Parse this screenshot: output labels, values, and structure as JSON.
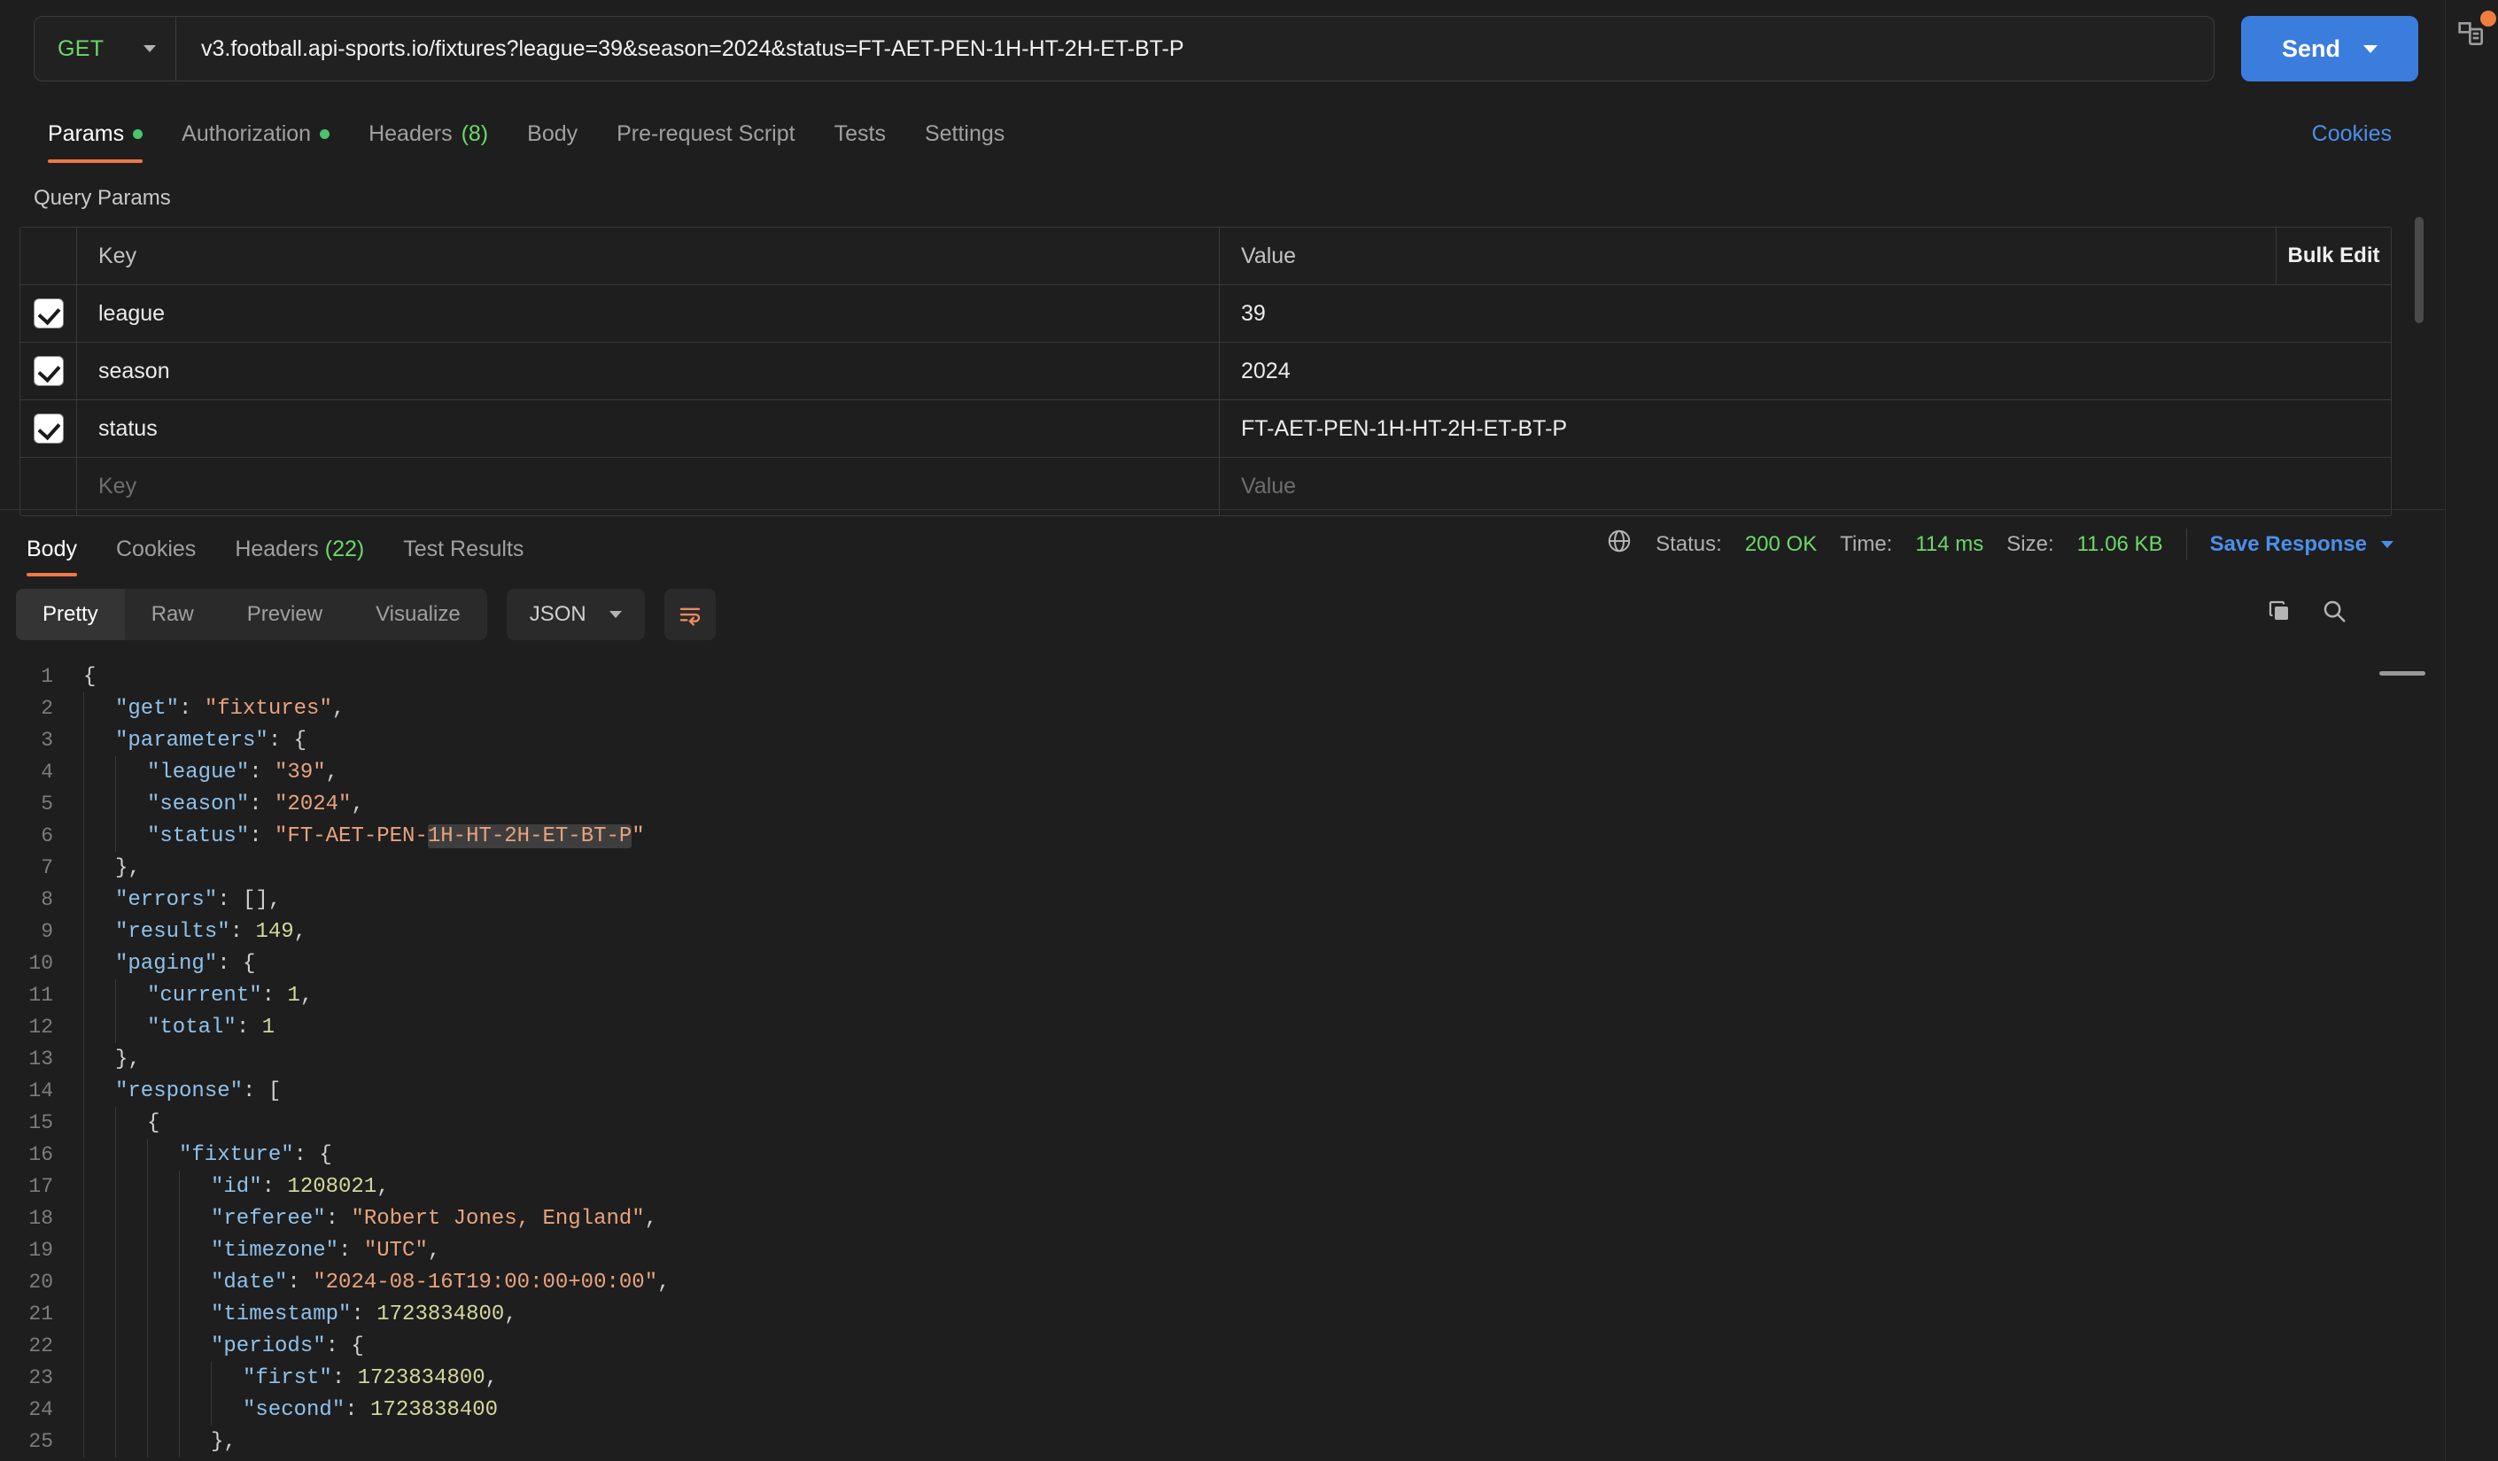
{
  "request": {
    "method": "GET",
    "url": "v3.football.api-sports.io/fixtures?league=39&season=2024&status=FT-AET-PEN-1H-HT-2H-ET-BT-P",
    "send_label": "Send",
    "tabs": [
      {
        "label": "Params",
        "dot": true,
        "active": true
      },
      {
        "label": "Authorization",
        "dot": true,
        "active": false
      },
      {
        "label": "Headers",
        "count": "(8)",
        "active": false
      },
      {
        "label": "Body",
        "active": false
      },
      {
        "label": "Pre-request Script",
        "active": false
      },
      {
        "label": "Tests",
        "active": false
      },
      {
        "label": "Settings",
        "active": false
      }
    ],
    "cookies_link": "Cookies"
  },
  "params": {
    "section_title": "Query Params",
    "columns": {
      "key": "Key",
      "value": "Value",
      "bulk": "Bulk Edit"
    },
    "rows": [
      {
        "checked": true,
        "key": "league",
        "value": "39"
      },
      {
        "checked": true,
        "key": "season",
        "value": "2024"
      },
      {
        "checked": true,
        "key": "status",
        "value": "FT-AET-PEN-1H-HT-2H-ET-BT-P"
      }
    ],
    "empty_row": {
      "key_placeholder": "Key",
      "value_placeholder": "Value"
    }
  },
  "response": {
    "tabs": [
      {
        "label": "Body",
        "active": true
      },
      {
        "label": "Cookies",
        "active": false
      },
      {
        "label": "Headers",
        "count": "(22)",
        "active": false
      },
      {
        "label": "Test Results",
        "active": false
      }
    ],
    "status_label": "Status:",
    "status_value": "200 OK",
    "time_label": "Time:",
    "time_value": "114 ms",
    "size_label": "Size:",
    "size_value": "11.06 KB",
    "save_label": "Save Response",
    "view_modes": [
      {
        "label": "Pretty",
        "active": true
      },
      {
        "label": "Raw",
        "active": false
      },
      {
        "label": "Preview",
        "active": false
      },
      {
        "label": "Visualize",
        "active": false
      }
    ],
    "format": "JSON",
    "body_lines": [
      {
        "n": "1",
        "indent": 0,
        "segs": [
          {
            "t": "{",
            "c": "p"
          }
        ]
      },
      {
        "n": "2",
        "indent": 1,
        "segs": [
          {
            "t": "\"get\"",
            "c": "k"
          },
          {
            "t": ": ",
            "c": "p"
          },
          {
            "t": "\"fixtures\"",
            "c": "s"
          },
          {
            "t": ",",
            "c": "p"
          }
        ]
      },
      {
        "n": "3",
        "indent": 1,
        "segs": [
          {
            "t": "\"parameters\"",
            "c": "k"
          },
          {
            "t": ": {",
            "c": "p"
          }
        ]
      },
      {
        "n": "4",
        "indent": 2,
        "segs": [
          {
            "t": "\"league\"",
            "c": "k"
          },
          {
            "t": ": ",
            "c": "p"
          },
          {
            "t": "\"39\"",
            "c": "s"
          },
          {
            "t": ",",
            "c": "p"
          }
        ]
      },
      {
        "n": "5",
        "indent": 2,
        "segs": [
          {
            "t": "\"season\"",
            "c": "k"
          },
          {
            "t": ": ",
            "c": "p"
          },
          {
            "t": "\"2024\"",
            "c": "s"
          },
          {
            "t": ",",
            "c": "p"
          }
        ]
      },
      {
        "n": "6",
        "indent": 2,
        "segs": [
          {
            "t": "\"status\"",
            "c": "k"
          },
          {
            "t": ": ",
            "c": "p"
          },
          {
            "t": "\"FT-AET-PEN-",
            "c": "s"
          },
          {
            "t": "1H-HT-2H-ET-BT-P",
            "c": "s",
            "hl": true
          },
          {
            "t": "\"",
            "c": "s"
          }
        ]
      },
      {
        "n": "7",
        "indent": 1,
        "segs": [
          {
            "t": "},",
            "c": "p"
          }
        ]
      },
      {
        "n": "8",
        "indent": 1,
        "segs": [
          {
            "t": "\"errors\"",
            "c": "k"
          },
          {
            "t": ": [],",
            "c": "p"
          }
        ]
      },
      {
        "n": "9",
        "indent": 1,
        "segs": [
          {
            "t": "\"results\"",
            "c": "k"
          },
          {
            "t": ": ",
            "c": "p"
          },
          {
            "t": "149",
            "c": "n"
          },
          {
            "t": ",",
            "c": "p"
          }
        ]
      },
      {
        "n": "10",
        "indent": 1,
        "segs": [
          {
            "t": "\"paging\"",
            "c": "k"
          },
          {
            "t": ": {",
            "c": "p"
          }
        ]
      },
      {
        "n": "11",
        "indent": 2,
        "segs": [
          {
            "t": "\"current\"",
            "c": "k"
          },
          {
            "t": ": ",
            "c": "p"
          },
          {
            "t": "1",
            "c": "n"
          },
          {
            "t": ",",
            "c": "p"
          }
        ]
      },
      {
        "n": "12",
        "indent": 2,
        "segs": [
          {
            "t": "\"total\"",
            "c": "k"
          },
          {
            "t": ": ",
            "c": "p"
          },
          {
            "t": "1",
            "c": "n"
          }
        ]
      },
      {
        "n": "13",
        "indent": 1,
        "segs": [
          {
            "t": "},",
            "c": "p"
          }
        ]
      },
      {
        "n": "14",
        "indent": 1,
        "segs": [
          {
            "t": "\"response\"",
            "c": "k"
          },
          {
            "t": ": [",
            "c": "p"
          }
        ]
      },
      {
        "n": "15",
        "indent": 2,
        "segs": [
          {
            "t": "{",
            "c": "p"
          }
        ]
      },
      {
        "n": "16",
        "indent": 3,
        "segs": [
          {
            "t": "\"fixture\"",
            "c": "k"
          },
          {
            "t": ": {",
            "c": "p"
          }
        ]
      },
      {
        "n": "17",
        "indent": 4,
        "segs": [
          {
            "t": "\"id\"",
            "c": "k"
          },
          {
            "t": ": ",
            "c": "p"
          },
          {
            "t": "1208021",
            "c": "n"
          },
          {
            "t": ",",
            "c": "p"
          }
        ]
      },
      {
        "n": "18",
        "indent": 4,
        "segs": [
          {
            "t": "\"referee\"",
            "c": "k"
          },
          {
            "t": ": ",
            "c": "p"
          },
          {
            "t": "\"Robert Jones, England\"",
            "c": "s"
          },
          {
            "t": ",",
            "c": "p"
          }
        ]
      },
      {
        "n": "19",
        "indent": 4,
        "segs": [
          {
            "t": "\"timezone\"",
            "c": "k"
          },
          {
            "t": ": ",
            "c": "p"
          },
          {
            "t": "\"UTC\"",
            "c": "s"
          },
          {
            "t": ",",
            "c": "p"
          }
        ]
      },
      {
        "n": "20",
        "indent": 4,
        "segs": [
          {
            "t": "\"date\"",
            "c": "k"
          },
          {
            "t": ": ",
            "c": "p"
          },
          {
            "t": "\"2024-08-16T19:00:00+00:00\"",
            "c": "s"
          },
          {
            "t": ",",
            "c": "p"
          }
        ]
      },
      {
        "n": "21",
        "indent": 4,
        "segs": [
          {
            "t": "\"timestamp\"",
            "c": "k"
          },
          {
            "t": ": ",
            "c": "p"
          },
          {
            "t": "1723834800",
            "c": "n"
          },
          {
            "t": ",",
            "c": "p"
          }
        ]
      },
      {
        "n": "22",
        "indent": 4,
        "segs": [
          {
            "t": "\"periods\"",
            "c": "k"
          },
          {
            "t": ": {",
            "c": "p"
          }
        ]
      },
      {
        "n": "23",
        "indent": 5,
        "segs": [
          {
            "t": "\"first\"",
            "c": "k"
          },
          {
            "t": ": ",
            "c": "p"
          },
          {
            "t": "1723834800",
            "c": "n"
          },
          {
            "t": ",",
            "c": "p"
          }
        ]
      },
      {
        "n": "24",
        "indent": 5,
        "segs": [
          {
            "t": "\"second\"",
            "c": "k"
          },
          {
            "t": ": ",
            "c": "p"
          },
          {
            "t": "1723838400",
            "c": "n"
          }
        ]
      },
      {
        "n": "25",
        "indent": 4,
        "segs": [
          {
            "t": "},",
            "c": "p"
          }
        ]
      }
    ]
  }
}
